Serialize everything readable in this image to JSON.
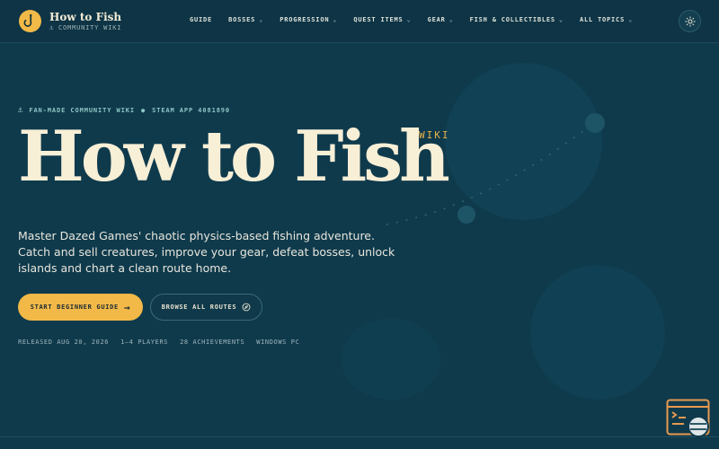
{
  "brand": {
    "title": "How to Fish",
    "subtitle": "COMMUNITY WIKI",
    "logo_icon": "fishing-hook-icon",
    "accent_color": "#f2b948"
  },
  "nav": {
    "items": [
      {
        "label": "GUIDE",
        "has_dropdown": false
      },
      {
        "label": "BOSSES",
        "has_dropdown": true
      },
      {
        "label": "PROGRESSION",
        "has_dropdown": true
      },
      {
        "label": "QUEST ITEMS",
        "has_dropdown": true
      },
      {
        "label": "GEAR",
        "has_dropdown": true
      },
      {
        "label": "FISH & COLLECTIBLES",
        "has_dropdown": true
      },
      {
        "label": "ALL TOPICS",
        "has_dropdown": true
      }
    ],
    "theme_toggle_icon": "sun-icon"
  },
  "hero": {
    "eyebrow_left": "FAN-MADE COMMUNITY WIKI",
    "eyebrow_right": "STEAM APP 4081890",
    "title": "How to Fish",
    "tag": "WIKI",
    "description": "Master Dazed Games' chaotic physics-based fishing adventure. Catch and sell creatures, improve your gear, defeat bosses, unlock islands and chart a clean route home.",
    "primary_button": "START BEGINNER GUIDE",
    "secondary_button": "BROWSE ALL ROUTES",
    "meta": [
      "RELEASED AUG 20, 2026",
      "1–4 PLAYERS",
      "28 ACHIEVEMENTS",
      "WINDOWS PC"
    ]
  },
  "colors": {
    "background": "#0f3a4c",
    "header": "#0e3445",
    "title": "#f7efd6",
    "eyebrow": "#8ec6c4"
  }
}
